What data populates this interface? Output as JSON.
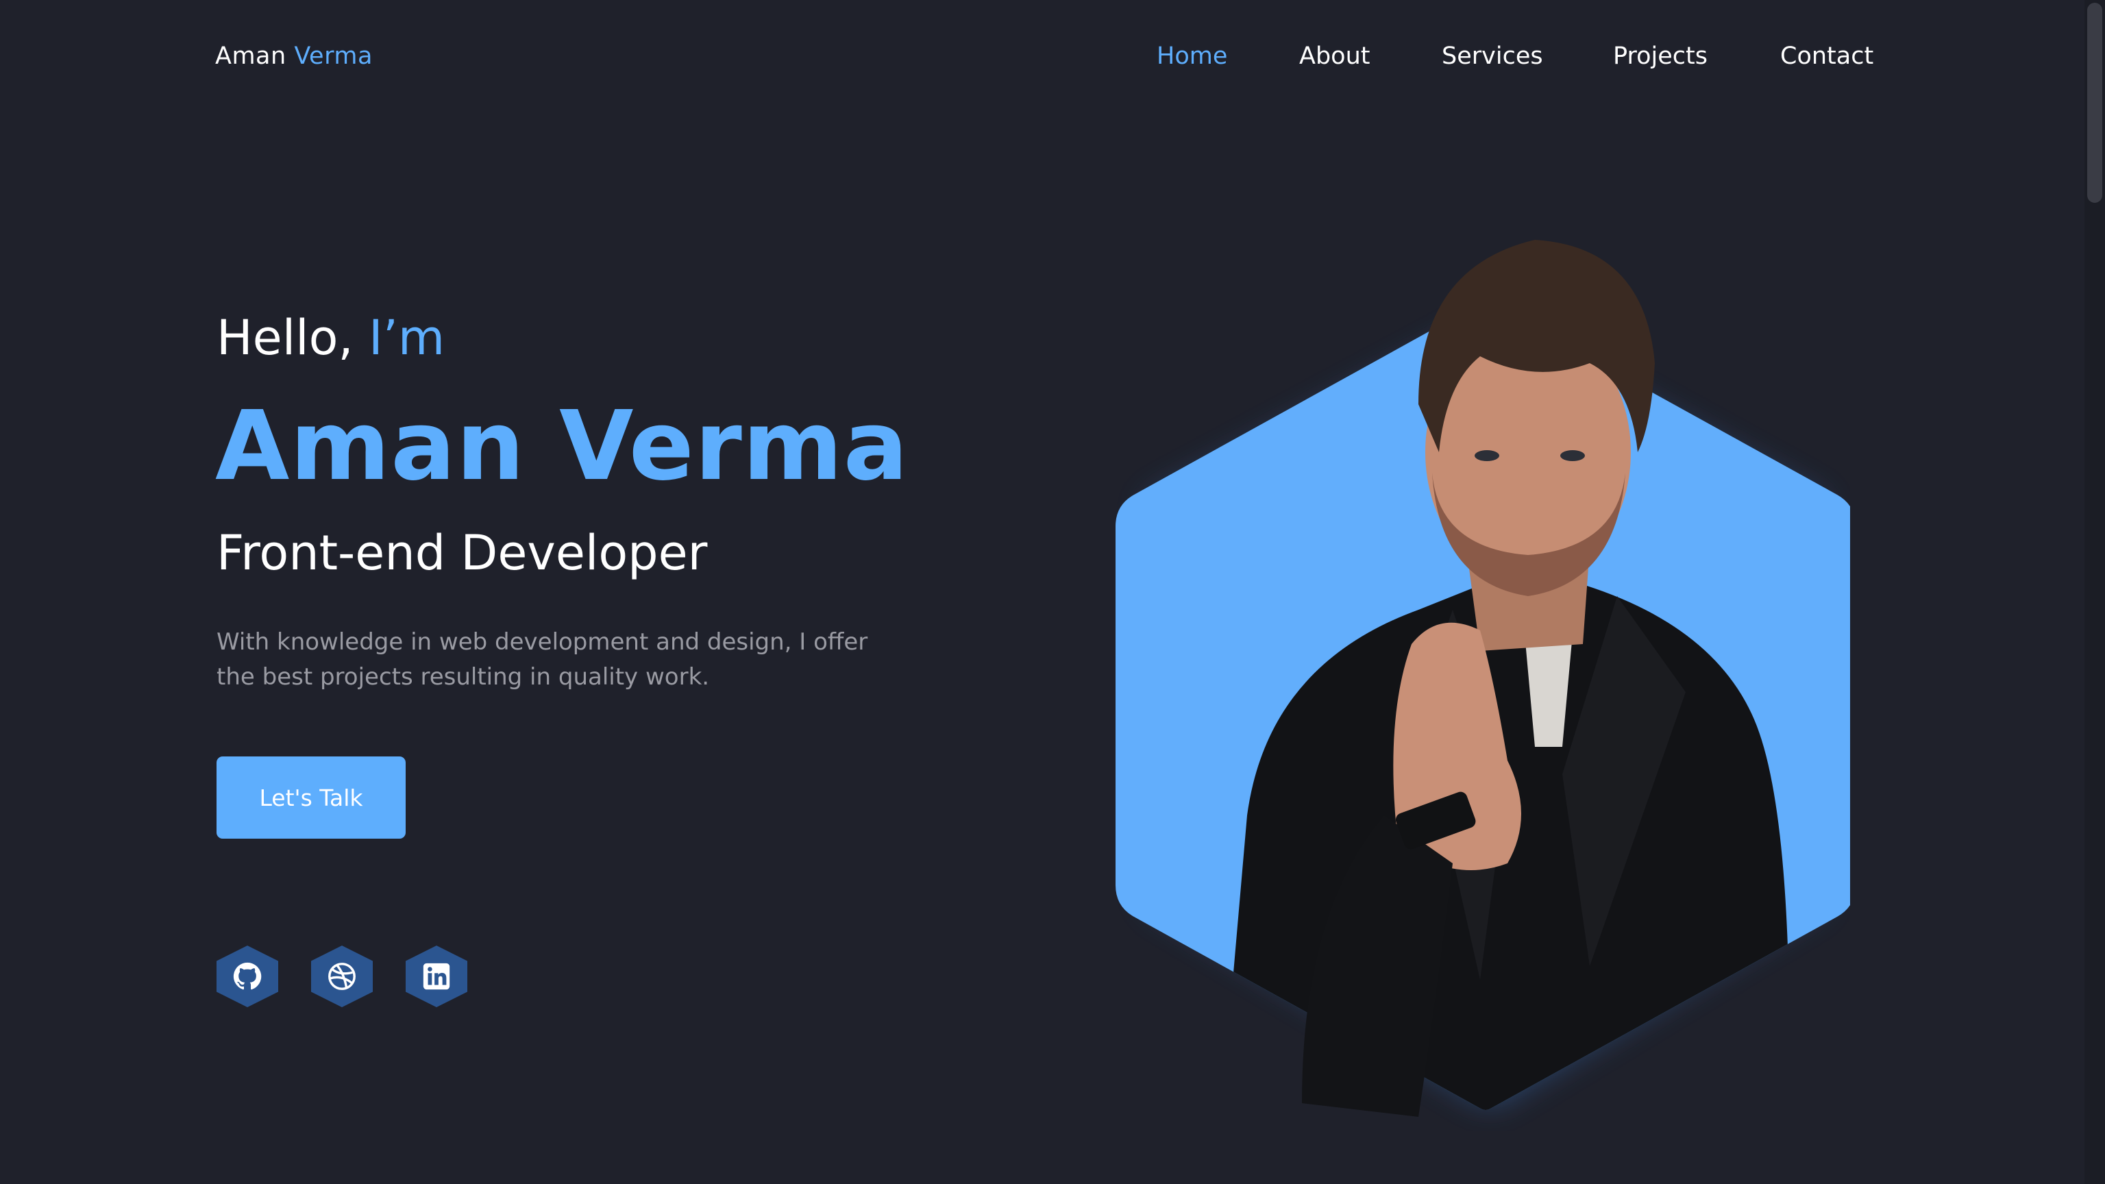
{
  "header": {
    "logo_first": "Aman",
    "logo_second": "Verma",
    "nav": [
      {
        "label": "Home",
        "active": true
      },
      {
        "label": "About",
        "active": false
      },
      {
        "label": "Services",
        "active": false
      },
      {
        "label": "Projects",
        "active": false
      },
      {
        "label": "Contact",
        "active": false
      }
    ]
  },
  "hero": {
    "greeting": "Hello,",
    "greeting_accent": "I’m",
    "name": "Aman Verma",
    "role": "Front-end Developer",
    "description_line1": "With knowledge in web development and design, I offer",
    "description_line2": "the best projects resulting in quality work.",
    "cta_label": "Let's Talk"
  },
  "social": [
    {
      "icon": "github-icon"
    },
    {
      "icon": "dribbble-icon"
    },
    {
      "icon": "linkedin-icon"
    }
  ],
  "colors": {
    "background": "#1f212b",
    "accent": "#5eaefd",
    "text": "#ffffff",
    "muted": "#9a9ba3",
    "social_bg": "#2b5590"
  }
}
